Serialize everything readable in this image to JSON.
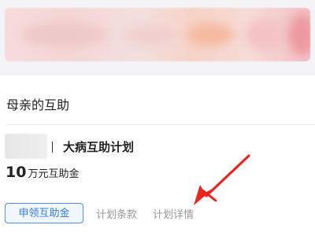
{
  "section": {
    "title": "母亲的互助"
  },
  "plan": {
    "name": "大病互助计划",
    "amount_value": "10",
    "amount_unit": "万元互助金"
  },
  "actions": {
    "apply_label": "申领互助金",
    "terms_label": "计划条款",
    "details_label": "计划详情"
  },
  "colors": {
    "accent_blue": "#2f7ae5",
    "annotation_arrow": "#e8261f"
  },
  "icons": {
    "annotation": "red-arrow-icon"
  }
}
